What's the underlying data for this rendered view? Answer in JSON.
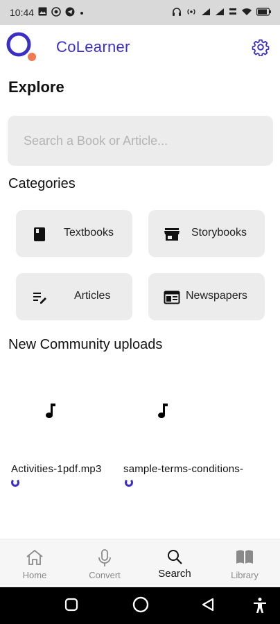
{
  "status_bar": {
    "time": "10:44",
    "left_icons": [
      "image-icon",
      "whatsapp-icon",
      "telegram-icon",
      "dot-icon"
    ],
    "right_icons": [
      "headphones-icon",
      "hotspot-icon",
      "signal-icon",
      "signal-icon",
      "data-speed-icon",
      "wifi-icon",
      "battery-icon"
    ]
  },
  "app_bar": {
    "title": "CoLearner",
    "accent_color": "#3a2fc4",
    "logo_dot_color": "#f07a52",
    "settings_icon": "gear-icon"
  },
  "explore": {
    "heading": "Explore",
    "search_placeholder": "Search a Book or Article..."
  },
  "categories": {
    "heading": "Categories",
    "items": [
      {
        "label": "Textbooks",
        "icon": "book-icon"
      },
      {
        "label": "Storybooks",
        "icon": "store-icon"
      },
      {
        "label": "Articles",
        "icon": "edit-list-icon"
      },
      {
        "label": "Newspapers",
        "icon": "newspaper-icon"
      }
    ]
  },
  "uploads": {
    "heading": "New Community uploads",
    "items": [
      {
        "filename": "Activities-1pdf.mp3",
        "icon": "music-note-icon"
      },
      {
        "filename": "sample-terms-conditions-",
        "icon": "music-note-icon"
      }
    ]
  },
  "bottom_nav": {
    "active": "Search",
    "items": [
      {
        "label": "Home",
        "icon": "home-icon"
      },
      {
        "label": "Convert",
        "icon": "mic-icon"
      },
      {
        "label": "Search",
        "icon": "search-icon"
      },
      {
        "label": "Library",
        "icon": "library-icon"
      }
    ]
  },
  "system_nav": {
    "buttons": [
      "recents-icon",
      "home-circle-icon",
      "back-icon",
      "accessibility-icon"
    ]
  }
}
